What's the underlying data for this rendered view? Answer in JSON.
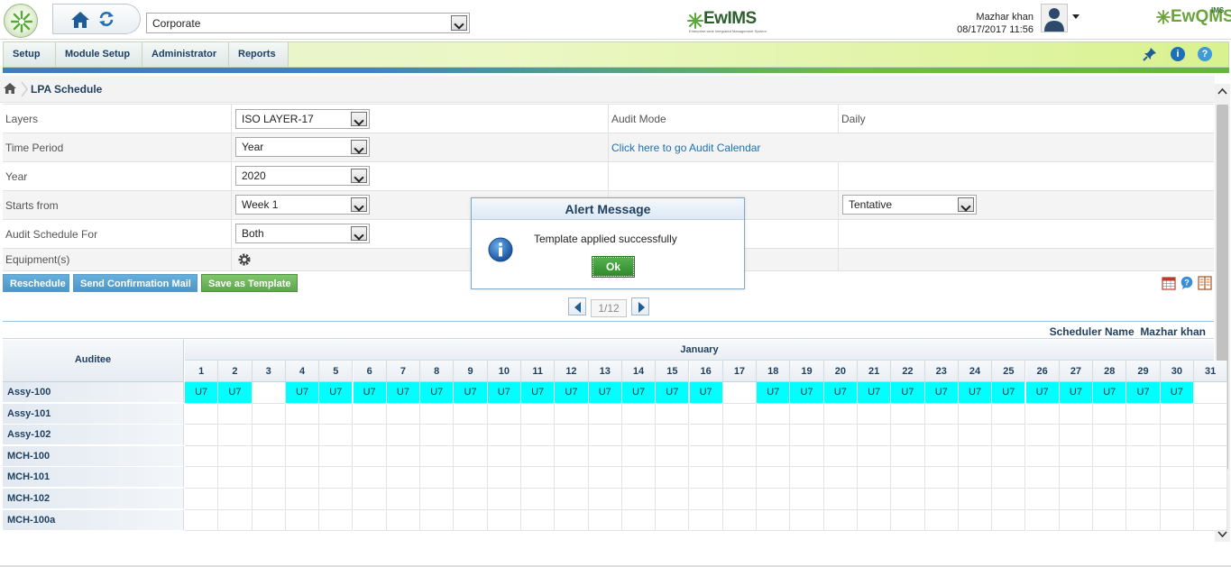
{
  "header": {
    "location_select": "Corporate",
    "center_logo": "EwIMS",
    "center_logo_tagline": "Enterprise-wide Integrated Management System",
    "user_name": "Mazhar khan",
    "datetime": "08/17/2017 11:56",
    "right_logo": "EwQMS",
    "right_logo_super": "IMS"
  },
  "menu": {
    "items": [
      {
        "label": "Setup"
      },
      {
        "label": "Module Setup"
      },
      {
        "label": "Administrator"
      },
      {
        "label": "Reports"
      }
    ],
    "icons": [
      "pin-icon",
      "info-icon",
      "help-icon"
    ]
  },
  "breadcrumb": {
    "title": "LPA Schedule"
  },
  "form": {
    "layers_label": "Layers",
    "layers_value": "ISO LAYER-17",
    "audit_mode_label": "Audit Mode",
    "audit_mode_value": "Daily",
    "time_period_label": "Time Period",
    "time_period_value": "Year",
    "calendar_link": "Click here to go Audit Calendar",
    "year_label": "Year",
    "year_value": "2020",
    "starts_from_label": "Starts from",
    "starts_from_value": "Week 1",
    "status_value": "Tentative",
    "schedule_for_label": "Audit Schedule For",
    "schedule_for_value": "Both",
    "equipment_label": "Equipment(s)"
  },
  "actions": {
    "reschedule": "Reschedule",
    "send_mail": "Send Confirmation Mail",
    "save_template": "Save as Template"
  },
  "pager": {
    "value": "1/12"
  },
  "scheduler": {
    "name_label": "Scheduler Name",
    "name_value": "Mazhar khan",
    "auditee_header": "Auditee",
    "month": "January",
    "days": [
      "1",
      "2",
      "3",
      "4",
      "5",
      "6",
      "7",
      "8",
      "9",
      "10",
      "11",
      "12",
      "13",
      "14",
      "15",
      "16",
      "17",
      "18",
      "19",
      "20",
      "21",
      "22",
      "23",
      "24",
      "25",
      "26",
      "27",
      "28",
      "29",
      "30",
      "31"
    ],
    "rows": [
      {
        "name": "Assy-100",
        "cells": [
          "U7",
          "U7",
          "",
          "U7",
          "U7",
          "U7",
          "U7",
          "U7",
          "U7",
          "U7",
          "U7",
          "U7",
          "U7",
          "U7",
          "U7",
          "U7",
          "",
          "U7",
          "U7",
          "U7",
          "U7",
          "U7",
          "U7",
          "U7",
          "U7",
          "U7",
          "U7",
          "U7",
          "U7",
          "U7",
          ""
        ]
      },
      {
        "name": "Assy-101",
        "cells": []
      },
      {
        "name": "Assy-102",
        "cells": []
      },
      {
        "name": "MCH-100",
        "cells": []
      },
      {
        "name": "MCH-101",
        "cells": []
      },
      {
        "name": "MCH-102",
        "cells": []
      },
      {
        "name": "MCH-100a",
        "cells": []
      }
    ]
  },
  "alert": {
    "title": "Alert Message",
    "message": "Template applied successfully",
    "ok_label": "Ok"
  },
  "colors": {
    "scheduled_cell": "#00ffff",
    "menu_text": "#1c3f63",
    "link": "#1a70b8",
    "ok_button": "#3a9a34"
  }
}
